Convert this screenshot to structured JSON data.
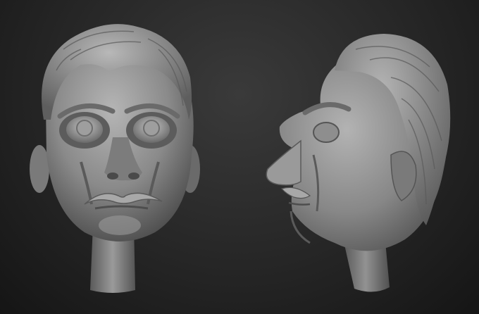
{
  "scene": {
    "background_color": "#262626",
    "material_color": "#8c8c8c",
    "views": [
      {
        "name": "front"
      },
      {
        "name": "profile"
      }
    ]
  }
}
